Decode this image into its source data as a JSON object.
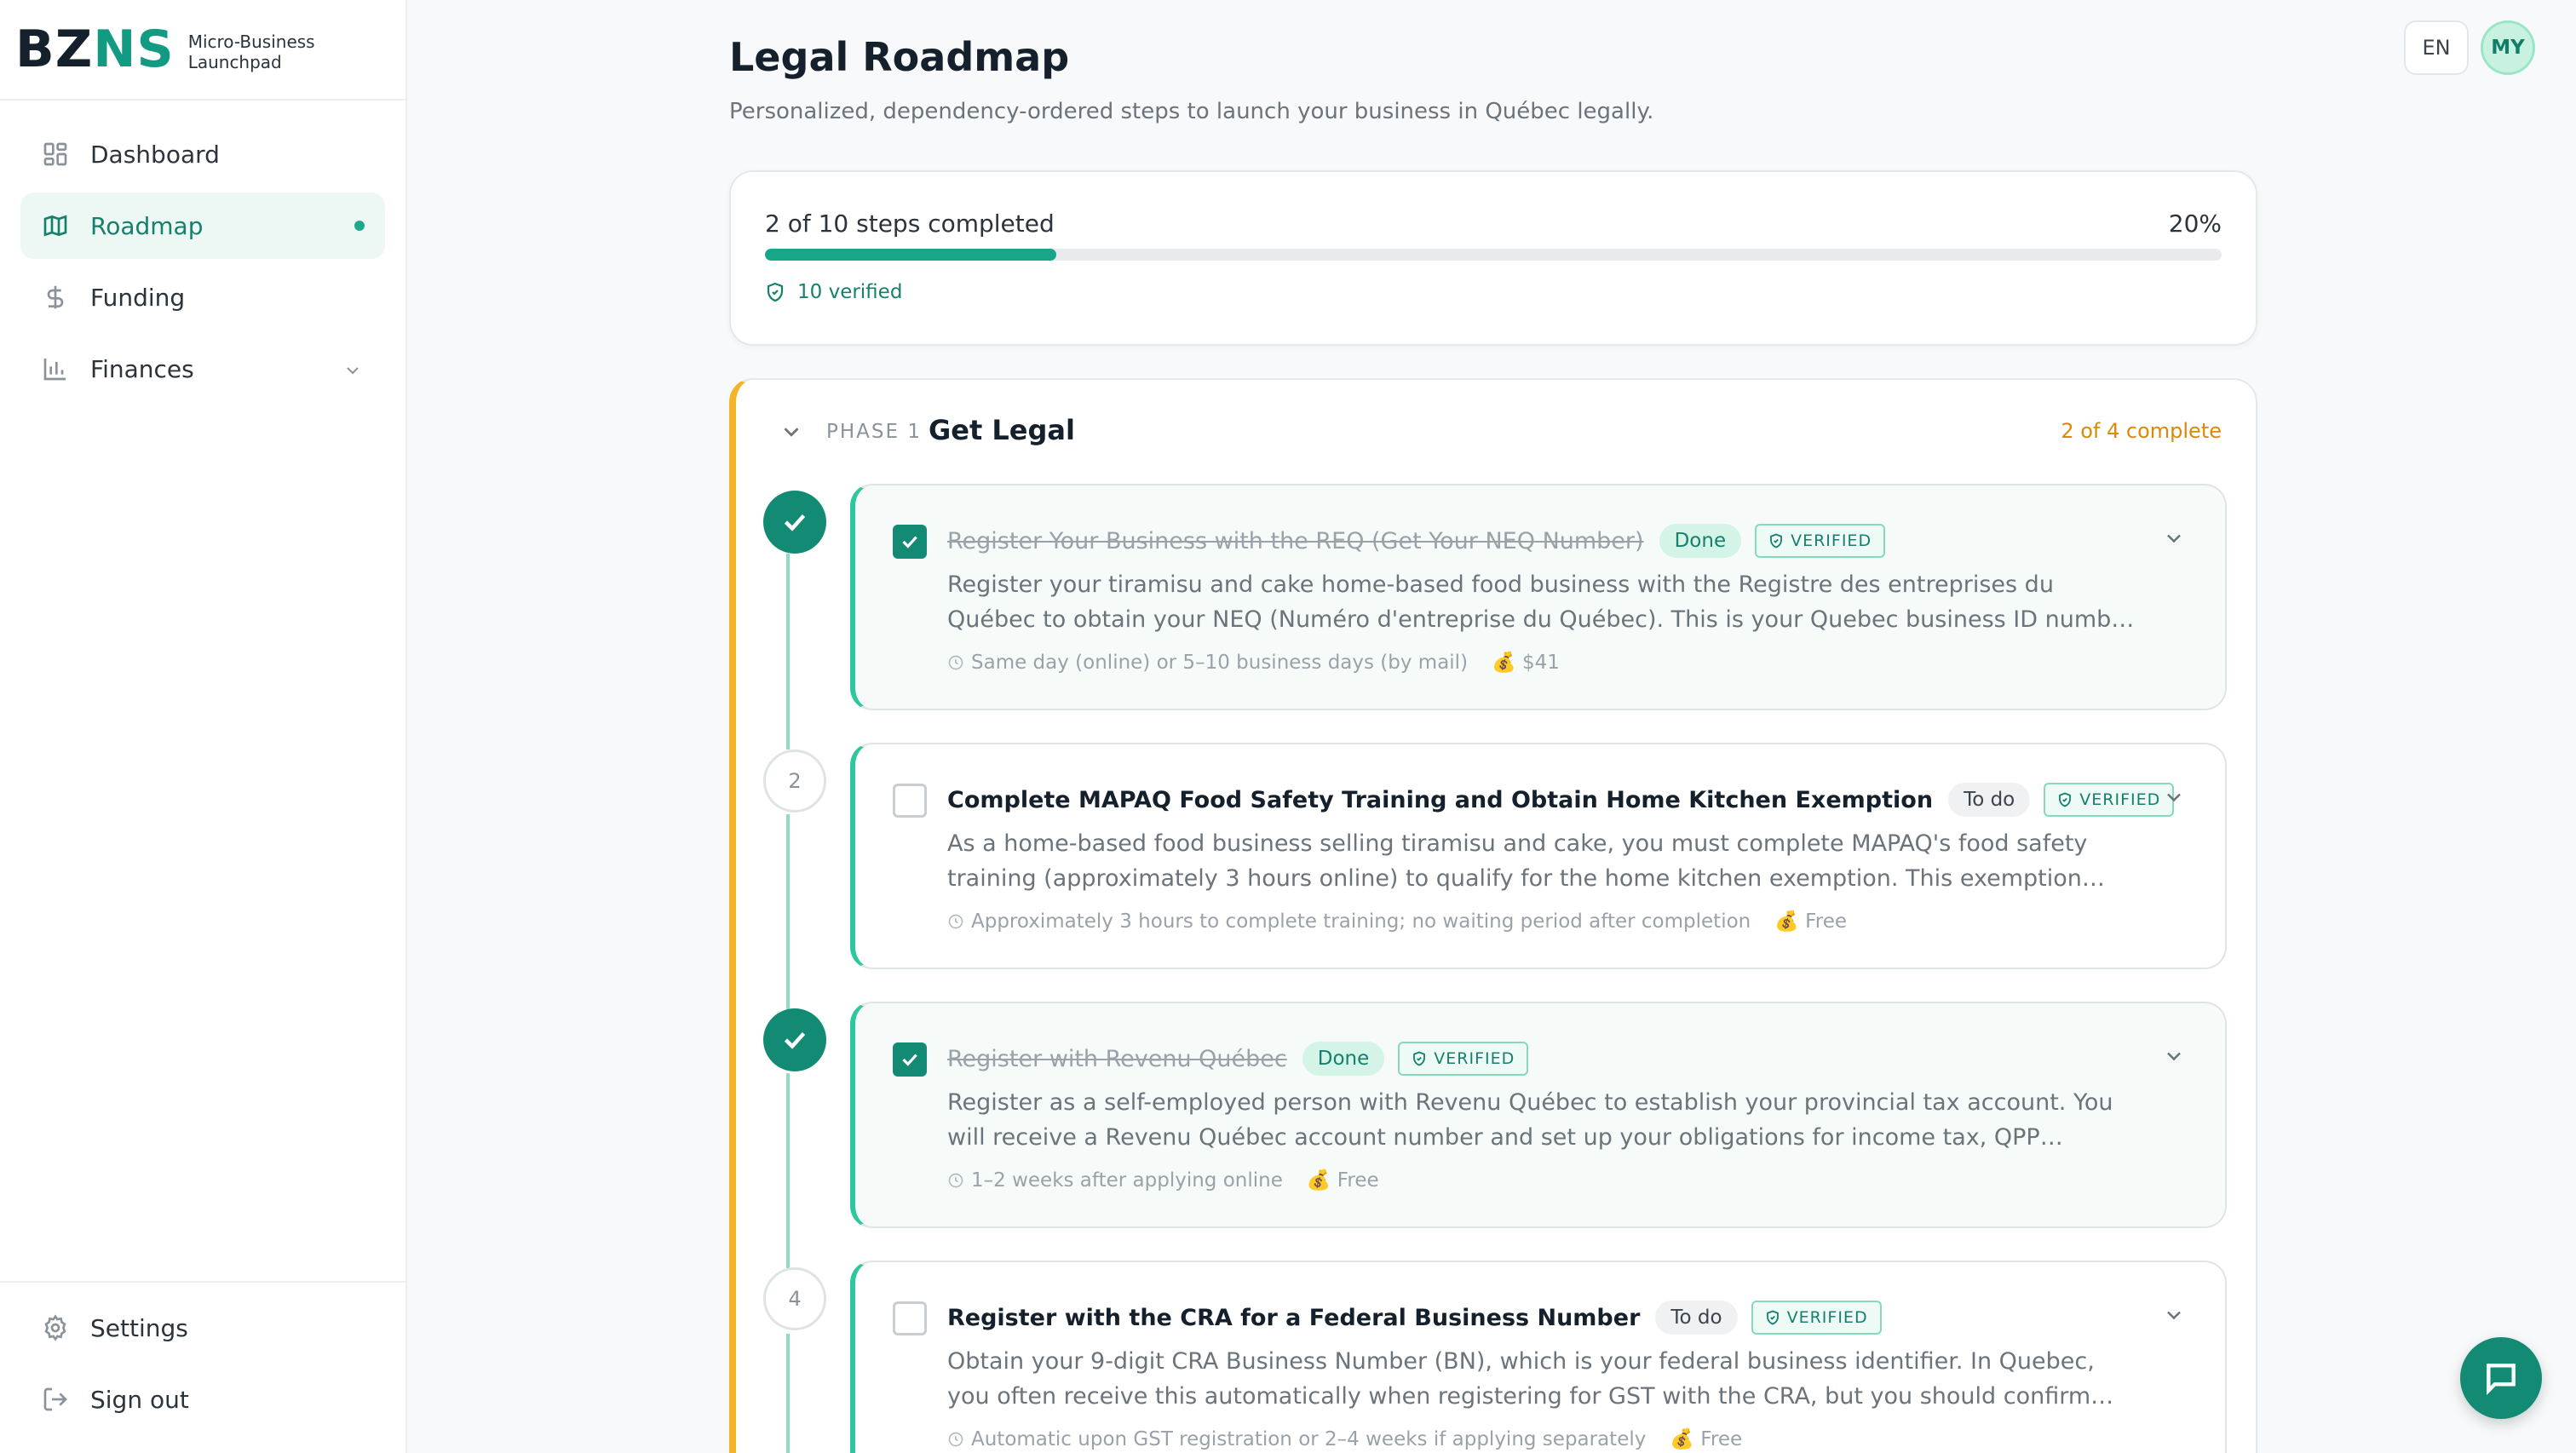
{
  "brand": {
    "logo_a": "BZ",
    "logo_b": "NS",
    "tagline": "Micro-Business Launchpad"
  },
  "nav": {
    "items": [
      {
        "label": "Dashboard",
        "icon": "dashboard-icon"
      },
      {
        "label": "Roadmap",
        "icon": "map-icon",
        "active": true
      },
      {
        "label": "Funding",
        "icon": "dollar-icon"
      },
      {
        "label": "Finances",
        "icon": "bar-chart-icon",
        "expandable": true
      }
    ],
    "bottom": [
      {
        "label": "Settings",
        "icon": "gear-icon"
      },
      {
        "label": "Sign out",
        "icon": "sign-out-icon"
      }
    ]
  },
  "header": {
    "lang": "EN",
    "avatar": "MY"
  },
  "page": {
    "title": "Legal Roadmap",
    "subtitle": "Personalized, dependency-ordered steps to launch your business in Québec legally."
  },
  "progress": {
    "text": "2 of 10 steps completed",
    "percent_label": "20%",
    "percent": 20,
    "verified": "10 verified"
  },
  "phase": {
    "label": "PHASE 1",
    "title": "Get Legal",
    "count": "2 of 4 complete",
    "accent": "#f5b427"
  },
  "steps": [
    {
      "number": "",
      "done": true,
      "title": "Register Your Business with the REQ (Get Your NEQ Number)",
      "status": "Done",
      "verified": "VERIFIED",
      "desc": "Register your tiramisu and cake home-based food business with the Registre des entreprises du Québec to obtain your NEQ (Numéro d'entreprise du Québec). This is your Quebec business ID number and is require...",
      "time": "Same day (online) or 5–10 business days (by mail)",
      "cost": "💰 $41"
    },
    {
      "number": "2",
      "done": false,
      "title": "Complete MAPAQ Food Safety Training and Obtain Home Kitchen Exemption",
      "status": "To do",
      "verified": "VERIFIED",
      "desc": "As a home-based food business selling tiramisu and cake, you must complete MAPAQ's food safety training (approximately 3 hours online) to qualify for the home kitchen exemption. This exemption allows you to...",
      "time": "Approximately 3 hours to complete training; no waiting period after completion",
      "cost": "💰 Free"
    },
    {
      "number": "",
      "done": true,
      "title": "Register with Revenu Québec",
      "status": "Done",
      "verified": "VERIFIED",
      "desc": "Register as a self-employed person with Revenu Québec to establish your provincial tax account. You will receive a Revenu Québec account number and set up your obligations for income tax, QPP contributions,...",
      "time": "1–2 weeks after applying online",
      "cost": "💰 Free"
    },
    {
      "number": "4",
      "done": false,
      "title": "Register with the CRA for a Federal Business Number",
      "status": "To do",
      "verified": "VERIFIED",
      "desc": "Obtain your 9-digit CRA Business Number (BN), which is your federal business identifier. In Quebec, you often receive this automatically when registering for GST with the CRA, but you should confirm registration.",
      "time": "Automatic upon GST registration or 2–4 weeks if applying separately",
      "cost": "💰 Free"
    }
  ],
  "colors": {
    "brand_green": "#129b82",
    "accent_teal": "#18a68a",
    "phase_accent": "#f5b427"
  }
}
